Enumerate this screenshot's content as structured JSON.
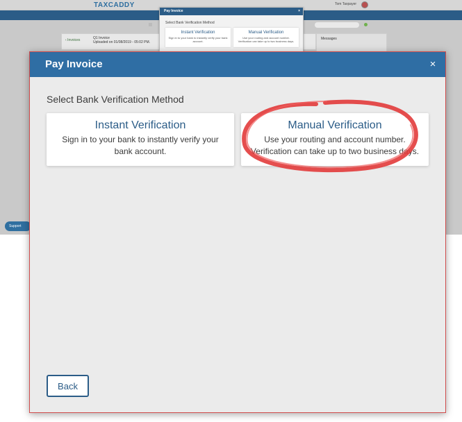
{
  "background": {
    "logo_text": "TAXCADDY",
    "user_name": "Tom Taxpayer",
    "back_link": "‹ Invoices",
    "invoice_title": "Q1 Invoice",
    "invoice_uploaded": "Uploaded on 01/08/2019 - 05:02 PM.",
    "messages_label": "Messages",
    "support_label": "Support"
  },
  "mini_modal": {
    "title": "Pay Invoice",
    "subtitle": "Select Bank Verification Method",
    "instant_title": "Instant Verification",
    "instant_desc": "Sign in to your bank to instantly verify your bank account.",
    "manual_title": "Manual Verification",
    "manual_desc": "Use your routing and account number. Verification can take up to two business days."
  },
  "modal": {
    "title": "Pay Invoice",
    "close_glyph": "×",
    "subtitle": "Select Bank Verification Method",
    "options": [
      {
        "title": "Instant Verification",
        "description": "Sign in to your bank to instantly verify your bank account."
      },
      {
        "title": "Manual Verification",
        "description": "Use your routing and account number. Verification can take up to two business days."
      }
    ],
    "back_label": "Back"
  },
  "colors": {
    "header_blue": "#2f6ea4",
    "title_blue": "#2b5c87",
    "annotation_red": "#e23b3b",
    "modal_bg": "#ebebeb"
  },
  "icons": {
    "close": "close-icon",
    "home": "home-icon",
    "flag": "flag-icon"
  }
}
